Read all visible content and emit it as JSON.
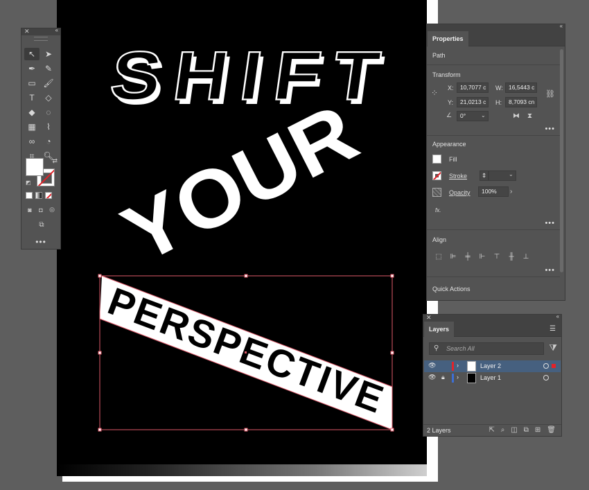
{
  "artwork": {
    "line1": "SHIFT",
    "line2": "YOUR",
    "line3": "PERSPECTIVE"
  },
  "tools_panel": {
    "more_label": "•••"
  },
  "properties": {
    "tab_label": "Properties",
    "path_label": "Path",
    "transform_label": "Transform",
    "x_label": "X:",
    "x_value": "10,7077 c",
    "y_label": "Y:",
    "y_value": "21,0213 c",
    "w_label": "W:",
    "w_value": "16,5443 c",
    "h_label": "H:",
    "h_value": "8,7093 cn",
    "angle_value": "0°",
    "appearance_label": "Appearance",
    "fill_label": "Fill",
    "stroke_label": "Stroke",
    "opacity_label": "Opacity",
    "opacity_value": "100%",
    "fx_label": "fx.",
    "align_label": "Align",
    "quick_actions_label": "Quick Actions",
    "more_label": "•••"
  },
  "layers": {
    "tab_label": "Layers",
    "search_placeholder": "Search All",
    "rows": [
      {
        "name": "Layer 2",
        "color": "#e2232a",
        "selected": true
      },
      {
        "name": "Layer 1",
        "color": "#3d6fd4",
        "selected": false
      }
    ],
    "footer_count": "2 Layers"
  },
  "colors": {
    "canvas_bg": "#5e5e5e",
    "panel_bg": "#535353",
    "selection": "#e05a6a",
    "accent_selected_row": "#46607f"
  }
}
